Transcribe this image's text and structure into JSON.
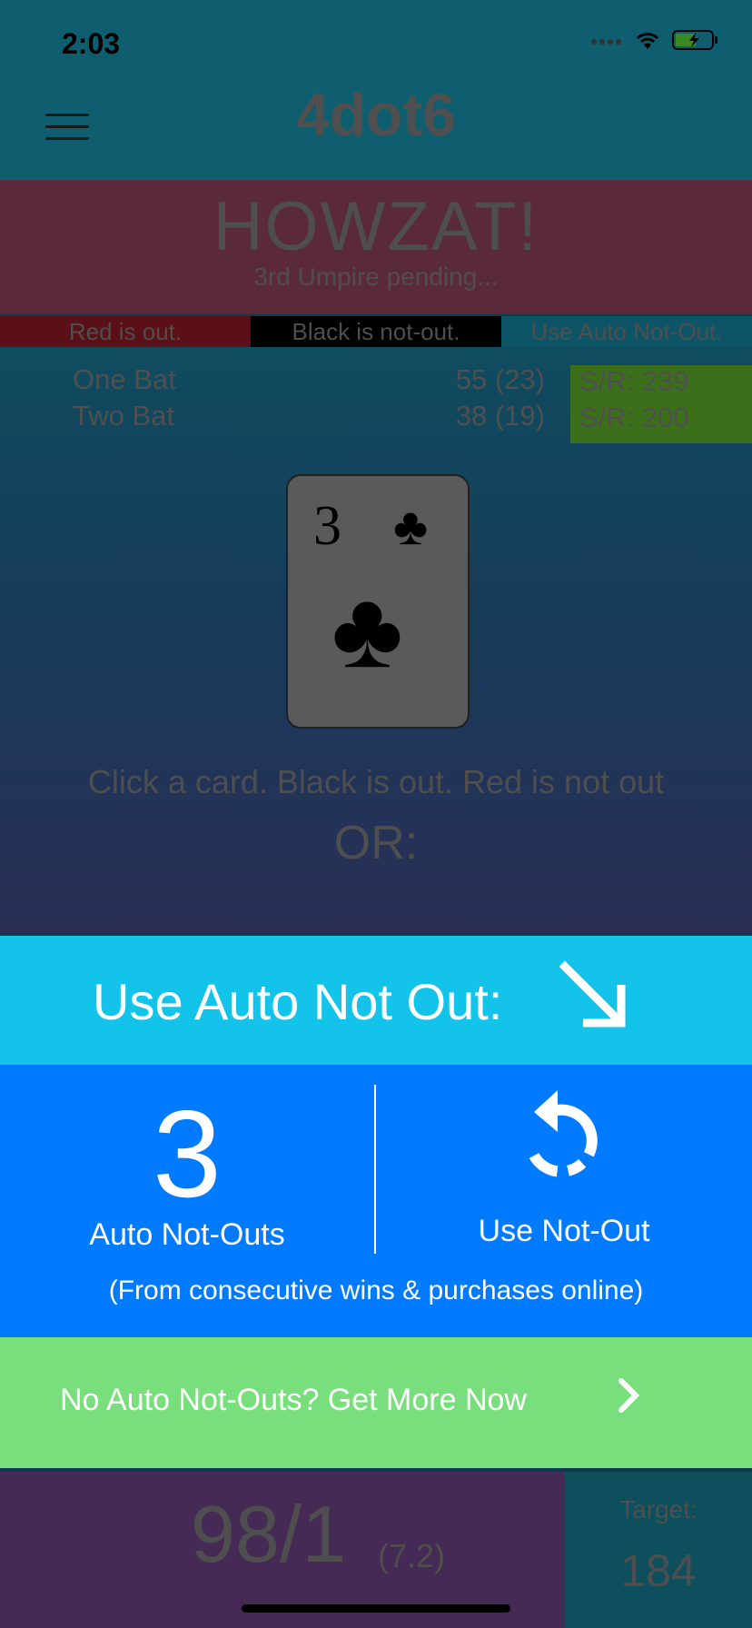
{
  "status_bar": {
    "time": "2:03",
    "icons": [
      "signal-icon",
      "wifi-icon",
      "battery-charging-icon"
    ]
  },
  "app": {
    "logo": "4dot6",
    "menu_icon": "hamburger-icon"
  },
  "banner": {
    "title": "HOWZAT!",
    "subtitle": "3rd Umpire pending..."
  },
  "legend": {
    "red": "Red is out.",
    "black": "Black is not-out.",
    "auto": "Use Auto Not-Out."
  },
  "batters": [
    {
      "name": "One Bat",
      "score": "55 (23)",
      "sr": "S/R: 239"
    },
    {
      "name": "Two Bat",
      "score": "38 (19)",
      "sr": "S/R: 200"
    }
  ],
  "card": {
    "rank": "3",
    "suit": "♣"
  },
  "instructions": {
    "text": "Click a card. Black is out. Red is not out",
    "or": "OR:"
  },
  "auto_not_out": {
    "header": "Use Auto Not Out:",
    "count": "3",
    "count_label": "Auto Not-Outs",
    "use_label": "Use Not-Out",
    "note": "(From consecutive wins & purchases online)",
    "get_more": "No Auto Not-Outs? Get More Now"
  },
  "scoreboard": {
    "score": "98/1",
    "overs": "(7.2)",
    "target_label": "Target:",
    "target_value": "184"
  },
  "colors": {
    "auto_header": "#14c3ea",
    "auto_body": "#007aff",
    "get_more": "#79de7c"
  }
}
